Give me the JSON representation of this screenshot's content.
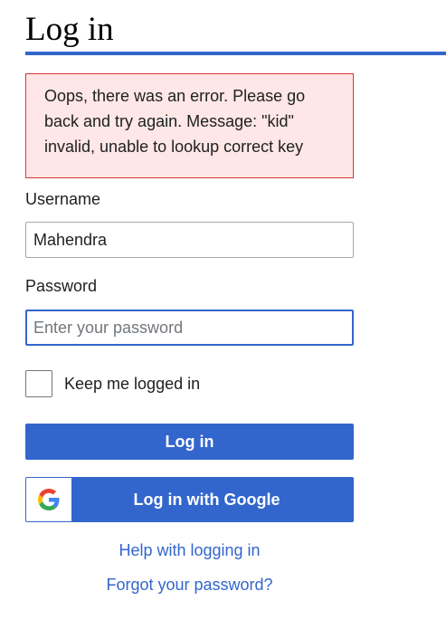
{
  "page": {
    "title": "Log in"
  },
  "error": {
    "message": "Oops, there was an error. Please go back and try again. Message: \"kid\" invalid, unable to lookup correct key"
  },
  "form": {
    "username_label": "Username",
    "username_value": "Mahendra",
    "password_label": "Password",
    "password_placeholder": "Enter your password",
    "remember_label": "Keep me logged in",
    "remember_checked": false,
    "login_button": "Log in",
    "google_button": "Log in with Google"
  },
  "links": {
    "help": "Help with logging in",
    "forgot": "Forgot your password?"
  },
  "colors": {
    "accent": "#3366cc",
    "error_background": "#fee7e6",
    "error_border": "#dd3333"
  },
  "icons": {
    "google": "google-logo-icon"
  }
}
